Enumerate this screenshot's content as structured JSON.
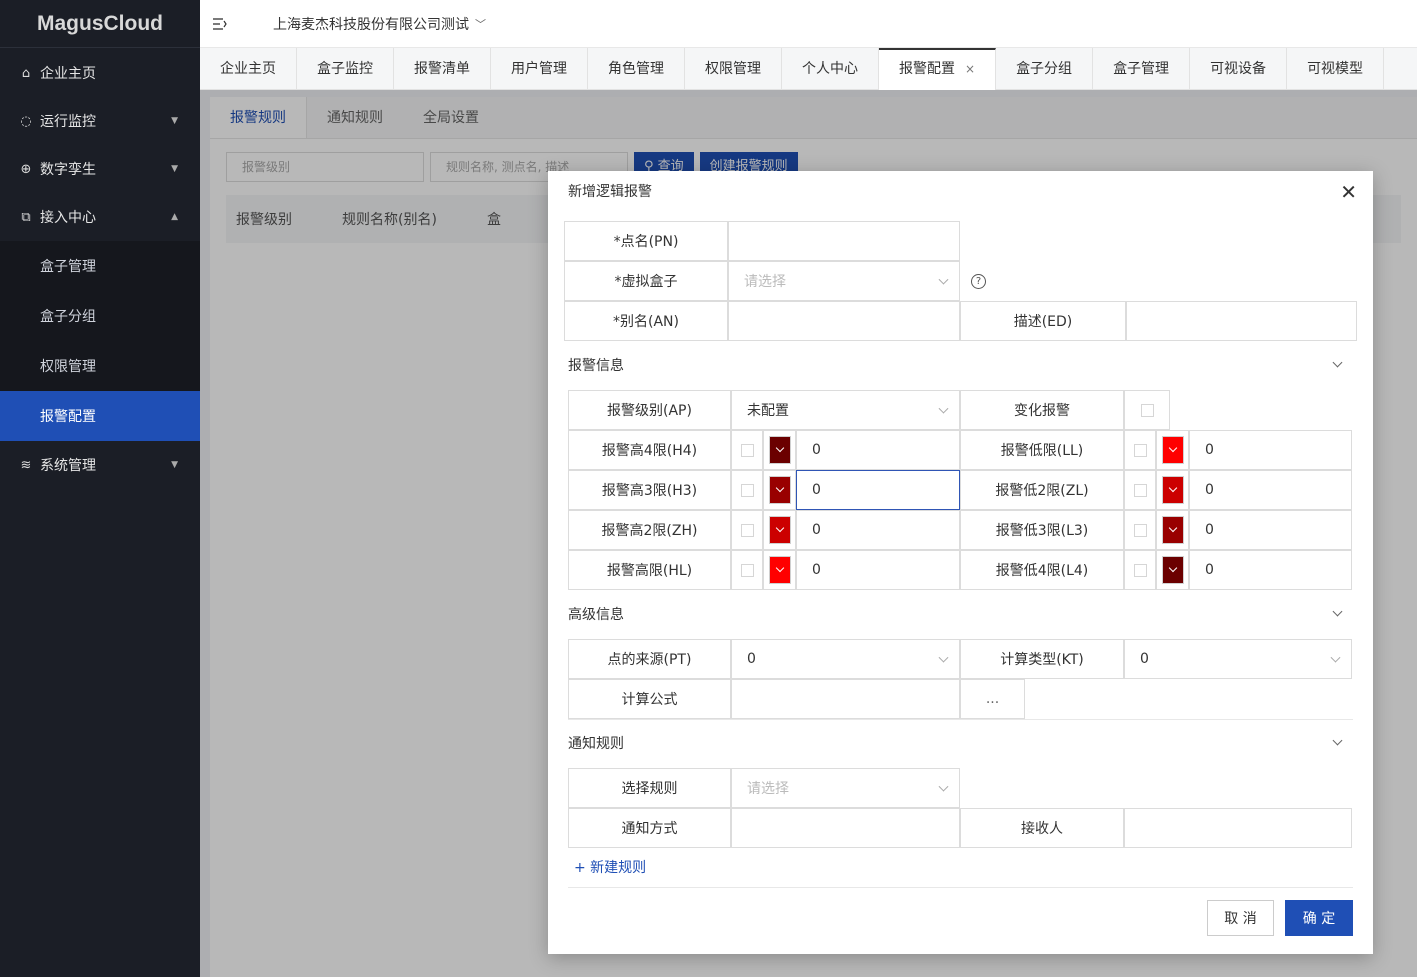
{
  "app": {
    "logo": "MagusCloud",
    "company": "上海麦杰科技股份有限公司测试"
  },
  "sidebar": {
    "items": [
      {
        "label": "企业主页",
        "icon": "home-icon"
      },
      {
        "label": "运行监控",
        "icon": "bulb-icon"
      },
      {
        "label": "数字孪生",
        "icon": "globe-icon"
      },
      {
        "label": "接入中心",
        "icon": "plug-icon"
      }
    ],
    "subitems": [
      "盒子管理",
      "盒子分组",
      "权限管理",
      "报警配置"
    ],
    "last": {
      "label": "系统管理",
      "icon": "layers-icon"
    }
  },
  "tabs": [
    "企业主页",
    "盒子监控",
    "报警清单",
    "用户管理",
    "角色管理",
    "权限管理",
    "个人中心",
    "报警配置",
    "盒子分组",
    "盒子管理",
    "可视设备",
    "可视模型"
  ],
  "subtabs": [
    "报警规则",
    "通知规则",
    "全局设置"
  ],
  "filter": {
    "level_placeholder": "报警级别",
    "search_placeholder": "规则名称, 测点名, 描述",
    "query_label": "查询",
    "create_label": "创建报警规则"
  },
  "table": {
    "headers": [
      "报警级别",
      "规则名称(别名)",
      "盒"
    ]
  },
  "modal": {
    "title": "新增逻辑报警",
    "pn_label": "*点名(PN)",
    "box_label": "*虚拟盒子",
    "box_placeholder": "请选择",
    "help": "?",
    "an_label": "*别名(AN)",
    "ed_label": "描述(ED)",
    "alarm_section": "报警信息",
    "ap_label": "报警级别(AP)",
    "ap_value": "未配置",
    "change_label": "变化报警",
    "limits_left": [
      {
        "label": "报警高4限(H4)",
        "value": "0",
        "color": "#6b0000"
      },
      {
        "label": "报警高3限(H3)",
        "value": "0",
        "color": "#990000"
      },
      {
        "label": "报警高2限(ZH)",
        "value": "0",
        "color": "#cc0000"
      },
      {
        "label": "报警高限(HL)",
        "value": "0",
        "color": "#ff0000"
      }
    ],
    "limits_right": [
      {
        "label": "报警低限(LL)",
        "value": "0",
        "color": "#ff0000"
      },
      {
        "label": "报警低2限(ZL)",
        "value": "0",
        "color": "#cc0000"
      },
      {
        "label": "报警低3限(L3)",
        "value": "0",
        "color": "#990000"
      },
      {
        "label": "报警低4限(L4)",
        "value": "0",
        "color": "#6b0000"
      }
    ],
    "adv_section": "高级信息",
    "pt_label": "点的来源(PT)",
    "pt_value": "0",
    "kt_label": "计算类型(KT)",
    "kt_value": "0",
    "formula_label": "计算公式",
    "formula_btn": "...",
    "notify_section": "通知规则",
    "rule_label": "选择规则",
    "rule_placeholder": "请选择",
    "method_label": "通知方式",
    "receiver_label": "接收人",
    "new_rule": "+ 新建规则",
    "cancel": "取 消",
    "ok": "确 定"
  }
}
